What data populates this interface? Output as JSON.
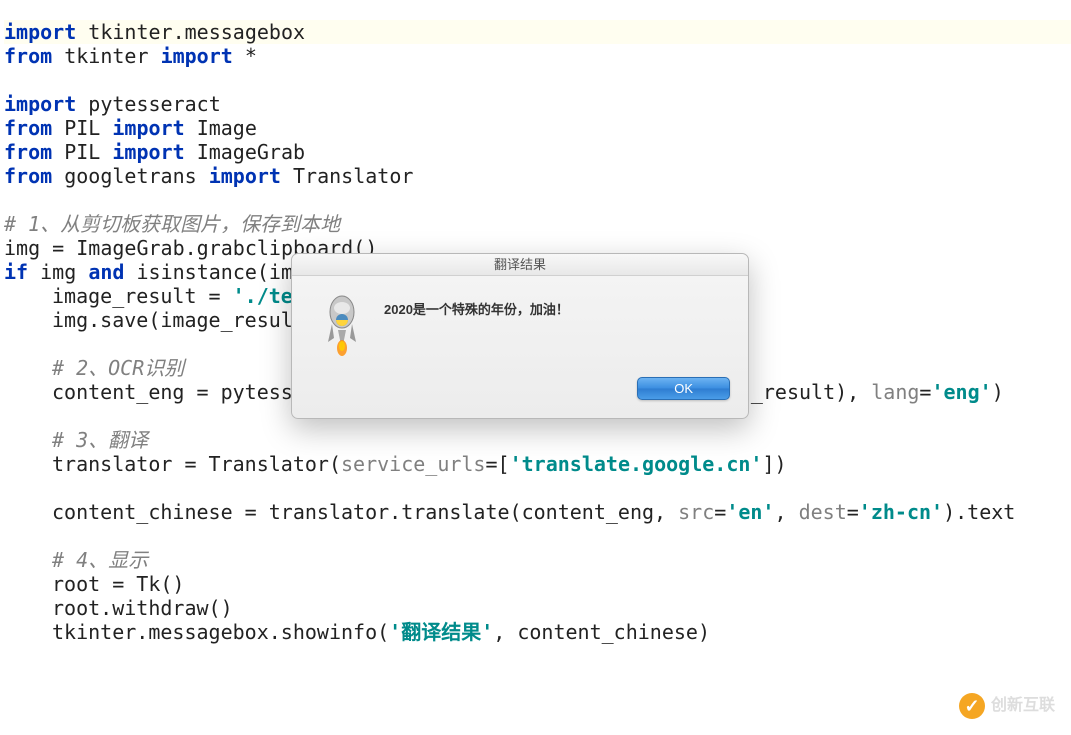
{
  "code": {
    "line1": {
      "kw": "import",
      "sp": " ",
      "id": "tkinter.messagebox"
    },
    "line2": {
      "kw1": "from",
      "sp1": " ",
      "id1": "tkinter",
      "sp2": " ",
      "kw2": "import",
      "sp3": " ",
      "id2": "*"
    },
    "line3": "",
    "line4": {
      "kw": "import",
      "sp": " ",
      "id": "pytesseract"
    },
    "line5": {
      "kw1": "from",
      "sp1": " ",
      "id1": "PIL",
      "sp2": " ",
      "kw2": "import",
      "sp3": " ",
      "id2": "Image"
    },
    "line6": {
      "kw1": "from",
      "sp1": " ",
      "id1": "PIL",
      "sp2": " ",
      "kw2": "import",
      "sp3": " ",
      "id2": "ImageGrab"
    },
    "line7": {
      "kw1": "from",
      "sp1": " ",
      "id1": "googletrans",
      "sp2": " ",
      "kw2": "import",
      "sp3": " ",
      "id2": "Translator"
    },
    "line8": "",
    "line9": {
      "comment": "# 1、从剪切板获取图片，保存到本地"
    },
    "line10": {
      "id": "img = ImageGrab.grabclipboard()"
    },
    "line11": {
      "kw1": "if",
      "sp1": " ",
      "id1": "img",
      "sp2": " ",
      "kw2": "and",
      "sp3": " ",
      "id2": "isinstance(im"
    },
    "line12": {
      "id1": "image_result = ",
      "str": "'./te"
    },
    "line13": {
      "id": "img.save(image_resul"
    },
    "line14": "",
    "line15": {
      "comment": "# 2、OCR识别"
    },
    "line16": {
      "id1": "content_eng = pytess",
      "id2": "_result), ",
      "param": "lang",
      "eq": "=",
      "str": "'eng'",
      "close": ")"
    },
    "line17": "",
    "line18": {
      "comment": "# 3、翻译"
    },
    "line19": {
      "id1": "translator = Translator(",
      "param": "service_urls",
      "eq": "=[",
      "str": "'translate.google.cn'",
      "close": "])"
    },
    "line20": "",
    "line21": {
      "id1": "content_chinese = translator.translate(content_eng, ",
      "param1": "src",
      "eq1": "=",
      "str1": "'en'",
      "comma": ", ",
      "param2": "dest",
      "eq2": "=",
      "str2": "'zh-cn'",
      "close": ").text"
    },
    "line22": "",
    "line23": {
      "comment": "# 4、显示"
    },
    "line24": {
      "id": "root = Tk()"
    },
    "line25": {
      "id": "root.withdraw()"
    },
    "line26": {
      "id1": "tkinter.messagebox.showinfo(",
      "str": "'翻译结果'",
      "id2": ", content_chinese)"
    }
  },
  "dialog": {
    "title": "翻译结果",
    "message": "2020是一个特殊的年份，加油！",
    "ok_label": "OK"
  },
  "watermark": {
    "text": "创新互联"
  }
}
